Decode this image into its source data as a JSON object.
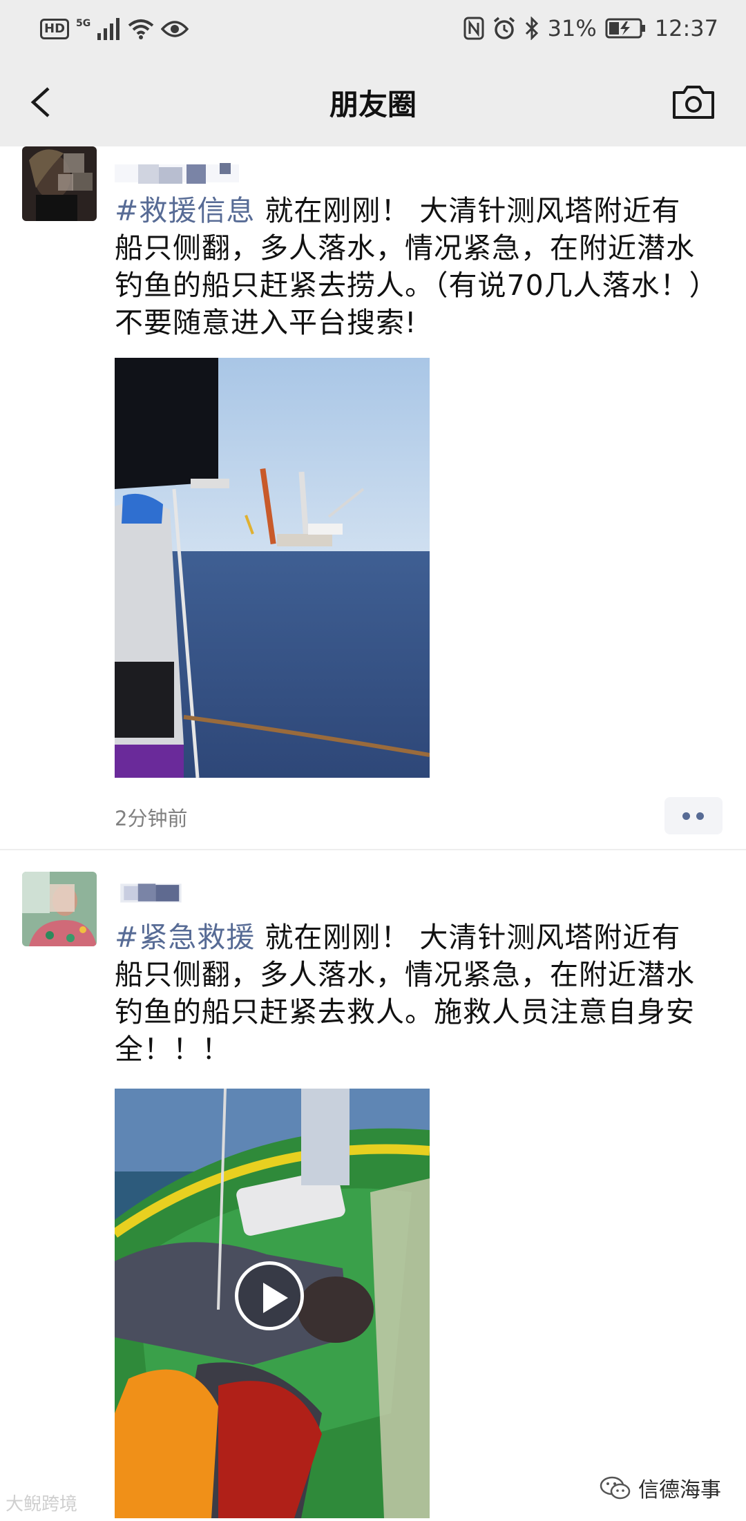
{
  "status_bar": {
    "hd": "HD",
    "network": "5G",
    "battery_pct": "31%",
    "time": "12:37"
  },
  "nav": {
    "title": "朋友圈"
  },
  "posts": [
    {
      "tag": "#救援信息",
      "text": " 就在刚刚！ 大清针测风塔附近有船只侧翻，多人落水，情况紧急，在附近潜水 钓鱼的船只赶紧去捞人。（有说70几人落水！）不要随意进入平台搜索!",
      "time": "2分钟前"
    },
    {
      "tag": "#紧急救援",
      "text": " 就在刚刚！ 大清针测风塔附近有船只侧翻，多人落水，情况紧急，在附近潜水 钓鱼的船只赶紧去救人。施救人员注意自身安全！！！"
    }
  ],
  "watermarks": {
    "left": "大鲵跨境",
    "right": "信德海事"
  },
  "colors": {
    "bar_bg": "#ededed",
    "link_blue": "#576b95",
    "time_gray": "#808080"
  }
}
